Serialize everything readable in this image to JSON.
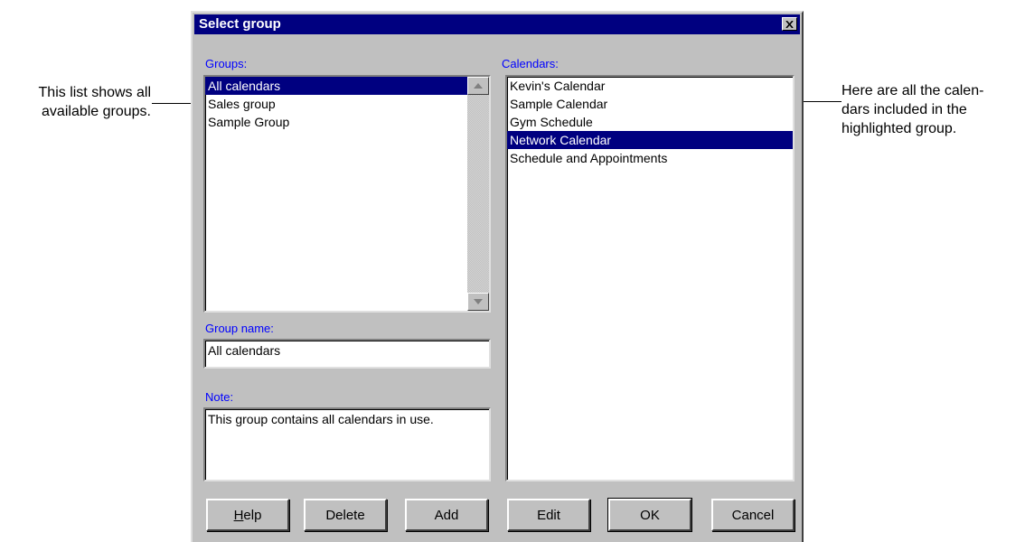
{
  "callouts": {
    "left": [
      "This list shows all",
      "available groups."
    ],
    "right": [
      "Here are all the calen-",
      "dars included in the",
      "highlighted group."
    ]
  },
  "dialog": {
    "title": "Select group",
    "groups_label": "Groups:",
    "groups": [
      "All calendars",
      "Sales group",
      "Sample Group"
    ],
    "selected_group": "All calendars",
    "calendars_label": "Calendars:",
    "calendars": [
      "Kevin's Calendar",
      "Sample Calendar",
      "Gym Schedule",
      "Network Calendar",
      "Schedule and Appointments"
    ],
    "selected_calendar": "Network Calendar",
    "group_name_label": "Group name:",
    "group_name_value": "All calendars",
    "note_label": "Note:",
    "note_value": "This group contains all calendars in use.",
    "buttons": {
      "help": {
        "label": "Help",
        "mnemonic": "H"
      },
      "delete": {
        "label": "Delete"
      },
      "add": {
        "label": "Add"
      },
      "edit": {
        "label": "Edit"
      },
      "ok": {
        "label": "OK"
      },
      "cancel": {
        "label": "Cancel"
      }
    }
  },
  "colors": {
    "title_bar": "#000080",
    "selection": "#000080",
    "label_text": "#0000ff",
    "dialog_face": "#c0c0c0"
  }
}
